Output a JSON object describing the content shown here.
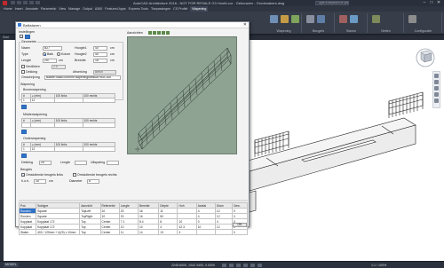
{
  "app": {
    "title": "AutoCAD Architecture 2016 - NOT FOR RESALE   G3 Hoofd.cur - Gebouwen - Grootmakers.dwg",
    "search_placeholder": "Type a keyword or phrase",
    "menu": [
      "Home",
      "Insert",
      "Annotate",
      "Parametric",
      "View",
      "Manage",
      "Output",
      "A360",
      "Featured Apps",
      "Express Tools",
      "Toepassingen",
      "CS Profiel",
      "Wapening"
    ],
    "active_menu": "Wapening",
    "ribbon_groups": [
      "Wapening",
      "Beugels",
      "Staven",
      "Netten",
      "Configuratie"
    ],
    "doc_tabs": [
      "Start",
      "Grootmakers*",
      "+"
    ],
    "status": {
      "model": "MODEL",
      "coords": "2245.6000, 1042.3400, 0.0000",
      "zoom": "1:1 / 100%"
    }
  },
  "dialog": {
    "title": "Balkstaven",
    "sections": {
      "instellingen": "Instellingen",
      "geometrie": "Geometrie",
      "wapening": "Wapening",
      "bovenwapening": "Bovenwapening",
      "middenwapening": "Middenwapening",
      "onderwapening": "Onderwapening",
      "beugels": "Beugels",
      "preview": "Aanzichten"
    },
    "fields": {
      "naam_label": "Naam",
      "naam": "B27",
      "type_label": "Type",
      "type_options": [
        "Balk",
        "Kolom"
      ],
      "hoogte1_label": "Hoogte1",
      "hoogte1": "40",
      "hoogte2_label": "Hoogte2",
      "hoogte2": "40",
      "lengte_label": "Lengte",
      "lengte": "257",
      "breedte_label": "Breedte",
      "breedte": "18",
      "unit": "cm",
      "verdikken_label": "Verdikken",
      "dekking_label": "Dekking",
      "dekking": "2.5",
      "omschrijving_label": "Omschrijving",
      "omschrijving": "Balken staal conform wapeningsbesluit HEB 300",
      "afwerking_label": "Afwerking",
      "afwerking": "Beton",
      "dekking2_label": "Dekking",
      "dekking2": "25",
      "lengte2_label": "Lengte",
      "lengte2": "",
      "uitsparing_label": "Uitsparing",
      "uitsparing": "",
      "beugels_diam_label": "Diameter",
      "beugels_diam": "8",
      "hoh_label": "h.o.h.",
      "hoh": "15",
      "beugel_opts": [
        "Omsluitende beugels links",
        "Omsluitende beugels rechts"
      ]
    },
    "wap_grid_headers": [
      "#",
      "⌀ (mm)",
      "100 links",
      "100 rechts"
    ],
    "bov_row": [
      "1",
      "12",
      "",
      ""
    ],
    "mid_row": [
      "",
      "",
      "",
      ""
    ],
    "ond_row": [
      "1",
      "12",
      "",
      ""
    ],
    "table": {
      "headers": [
        "Pos",
        "Subtype",
        "Aanzicht",
        "Referentie",
        "Lengte",
        "Breedte",
        "Diepte",
        "Hoh",
        "Aantal",
        "Diam",
        "Gew."
      ],
      "rows": [
        [
          "Ronden",
          "Square",
          "TopLeft",
          "10",
          "20",
          "16",
          "11",
          "",
          "4",
          "12",
          "0"
        ],
        [
          "Ronden",
          "Square",
          "TopRight",
          "10",
          "20",
          "16",
          "50",
          "",
          "4",
          "12",
          "0"
        ],
        [
          "Kopplaat",
          "Kopplaat 172",
          "Top",
          "Center",
          "7.1",
          "8.4",
          "8",
          "10",
          "0",
          "4",
          "0"
        ],
        [
          "Kopplaat",
          "Kopplaat 172",
          "Top",
          "Center",
          "10",
          "10",
          "4",
          "42.3",
          "10",
          "12",
          "0"
        ],
        [
          "Stalen",
          "400 / 125mm + h(20) x 10mm",
          "Top",
          "Center",
          "11",
          "14",
          "13",
          "4",
          "",
          "",
          "0"
        ]
      ]
    },
    "ok_label": "OK"
  }
}
